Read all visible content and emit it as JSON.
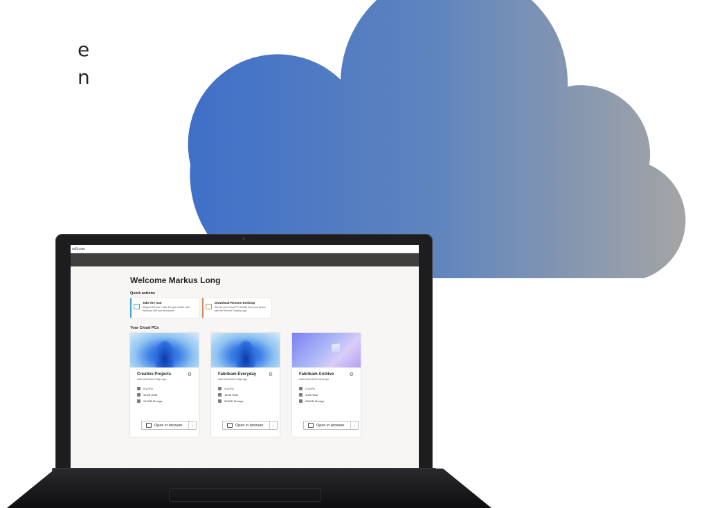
{
  "headline": {
    "line1": "e",
    "line2": "n"
  },
  "colors": {
    "cloud_left": "#3f6fc8",
    "cloud_right": "#a5a5a5",
    "topbar": "#3f3f3f",
    "tour_accent": "#4aa3c8",
    "download_accent": "#d28a5c"
  },
  "browser": {
    "url": "soft.com"
  },
  "page": {
    "welcome": "Welcome Markus Long",
    "quick_actions_title": "Quick actions",
    "quick_actions": [
      {
        "title": "Take the tour",
        "description": "Skipped the tour? Take it to get familiar with Windows 365 and its features.",
        "icon": "chat-icon"
      },
      {
        "title": "Download Remote Desktop",
        "description": "Access your Cloud PC directly from your device with the Remote Desktop app.",
        "icon": "monitor-icon"
      }
    ],
    "cloud_pcs_title": "Your Cloud PCs",
    "cloud_pcs": [
      {
        "name": "Creative Projects",
        "last": "Last connected 4 days ago",
        "cpu": "8 vCPU",
        "ram": "32GB RAM",
        "storage": "512GB Storage",
        "open_label": "Open in browser"
      },
      {
        "name": "Fabrikam Everyday",
        "last": "Last connected 2 days ago",
        "cpu": "4 vCPU",
        "ram": "16GB RAM",
        "storage": "256GB Storage",
        "open_label": "Open in browser"
      },
      {
        "name": "Fabrikam Archive",
        "last": "Last connected 6 hours ago",
        "cpu": "2 vCPU",
        "ram": "4GB RAM",
        "storage": "256GB Storage",
        "open_label": "Open in browser"
      }
    ]
  }
}
